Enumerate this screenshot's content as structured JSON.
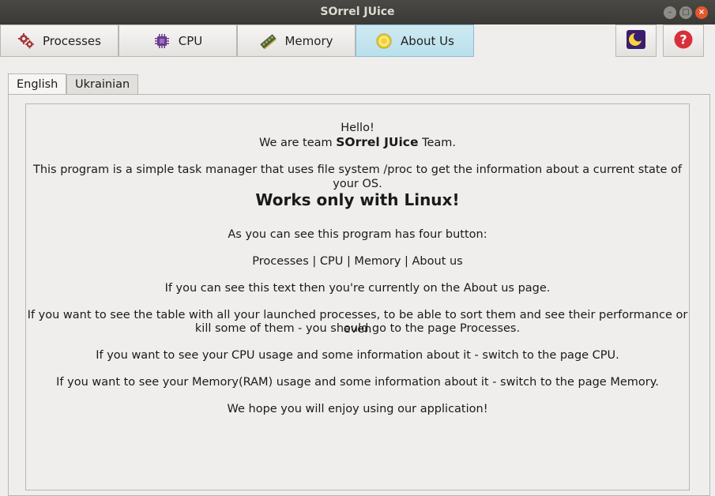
{
  "window": {
    "title": "SOrrel JUice",
    "minimize_glyph": "–",
    "maximize_glyph": "□",
    "close_glyph": "×"
  },
  "nav": {
    "items": [
      {
        "label": "Processes",
        "icon": "gears-icon",
        "active": false
      },
      {
        "label": "CPU",
        "icon": "chip-icon",
        "active": false
      },
      {
        "label": "Memory",
        "icon": "ram-icon",
        "active": false
      },
      {
        "label": "About Us",
        "icon": "info-coin-icon",
        "active": true
      }
    ],
    "theme_button_icon": "moon-icon",
    "help_button_icon": "help-icon",
    "accent_active": "#bde2ee"
  },
  "tabs": [
    {
      "label": "English",
      "active": true
    },
    {
      "label": "Ukrainian",
      "active": false
    }
  ],
  "about": {
    "hello": "Hello!",
    "team_prefix": "We are team ",
    "team_name": "SOrrel JUice",
    "team_suffix": " Team.",
    "intro": "This program is a simple task manager that uses file system /proc to get the information about a current state of your OS.",
    "warning": "Works only with Linux!",
    "buttons_intro": "As you can see this program has four button:",
    "buttons_list": "Processes | CPU | Memory | About us",
    "current_page": "If you can see this text then you're currently on the About us page.",
    "processes_info_line1": "If you want to see the table with all your launched processes, to be able to sort them and see their performance or even",
    "processes_info_line2": "kill some of them - you should go to the page Processes.",
    "cpu_info": "If you want to see your CPU usage and some information about it - switch to the page CPU.",
    "memory_info": "If you want to see your Memory(RAM) usage and some information about it - switch to the page Memory.",
    "closing": "We hope you will enjoy using our application!"
  }
}
